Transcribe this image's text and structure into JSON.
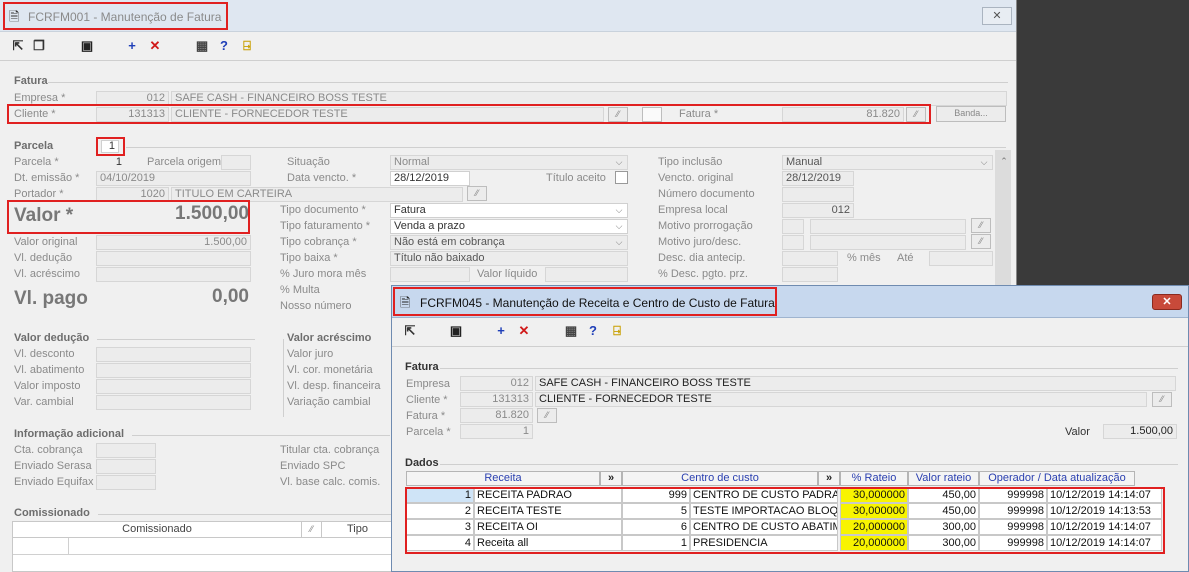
{
  "main_window": {
    "title": "FCRFM001 - Manutenção de Fatura",
    "close_glyph": "✕",
    "fatura": {
      "section": "Fatura",
      "empresa_label": "Empresa *",
      "empresa_code": "012",
      "empresa_name": "SAFE CASH - FINANCEIRO BOSS TESTE",
      "cliente_label": "Cliente *",
      "cliente_code": "131313",
      "cliente_name": "CLIENTE - FORNECEDOR TESTE",
      "fatura_label": "Fatura *",
      "fatura_value": "81.820",
      "banda_label": "Banda..."
    },
    "parcela": {
      "section": "Parcela",
      "section_value": "1",
      "parcela_label": "Parcela *",
      "parcela_value": "1",
      "parcela_origem_label": "Parcela origem",
      "dt_emissao_label": "Dt. emissão *",
      "dt_emissao_value": "04/10/2019",
      "portador_label": "Portador *",
      "portador_code": "1020",
      "portador_name": "TITULO EM CARTEIRA",
      "valor_label": "Valor *",
      "valor_value": "1.500,00",
      "valor_original_label": "Valor original",
      "valor_original_value": "1.500,00",
      "vl_deducao_label": "Vl. dedução",
      "vl_acrescimo_label": "Vl. acréscimo",
      "vl_pago_label": "Vl. pago",
      "vl_pago_value": "0,00",
      "situacao_label": "Situação",
      "situacao_value": "Normal",
      "data_vencto_label": "Data vencto. *",
      "data_vencto_value": "28/12/2019",
      "titulo_aceito_label": "Título aceito",
      "tipo_documento_label": "Tipo documento *",
      "tipo_documento_value": "Fatura",
      "tipo_faturamento_label": "Tipo faturamento *",
      "tipo_faturamento_value": "Venda a prazo",
      "tipo_cobranca_label": "Tipo cobrança *",
      "tipo_cobranca_value": "Não está em cobrança",
      "tipo_baixa_label": "Tipo baixa *",
      "tipo_baixa_value": "Título não baixado",
      "juro_mora_label": "% Juro mora mês",
      "valor_liquido_label": "Valor líquido",
      "multa_label": "% Multa",
      "nosso_numero_label": "Nosso número",
      "tipo_inclusao_label": "Tipo inclusão",
      "tipo_inclusao_value": "Manual",
      "vencto_original_label": "Vencto. original",
      "vencto_original_value": "28/12/2019",
      "numero_documento_label": "Número documento",
      "empresa_local_label": "Empresa local",
      "empresa_local_value": "012",
      "motivo_prorrogacao_label": "Motivo prorrogação",
      "motivo_juro_label": "Motivo juro/desc.",
      "desc_dia_antecip_label": "Desc. dia antecip.",
      "pct_mes_label": "% mês",
      "ate_label": "Até",
      "desc_pgto_label": "% Desc. pgto. prz."
    },
    "valor_deducao": {
      "section": "Valor dedução",
      "desconto": "Vl. desconto",
      "abatimento": "Vl. abatimento",
      "imposto": "Valor imposto",
      "cambial": "Var. cambial"
    },
    "valor_acrescimo": {
      "section": "Valor acréscimo",
      "juro": "Valor juro",
      "cor_monetaria": "Vl. cor. monetária",
      "desp_financeira": "Vl. desp. financeira",
      "variacao": "Variação cambial"
    },
    "info_adicional": {
      "section": "Informação adicional",
      "cta_cobranca": "Cta. cobrança",
      "serasa": "Enviado Serasa",
      "equifax": "Enviado Equifax",
      "titular": "Titular cta. cobrança",
      "spc": "Enviado SPC",
      "base_calc": "Vl. base calc. comis."
    },
    "comissionado": {
      "section": "Comissionado",
      "col_comissionado": "Comissionado",
      "col_tipo": "Tipo"
    }
  },
  "sub_window": {
    "title": "FCRFM045 - Manutenção de Receita e Centro de Custo de Fatura",
    "close_glyph": "✕",
    "fatura": {
      "section": "Fatura",
      "empresa_label": "Empresa",
      "empresa_code": "012",
      "empresa_name": "SAFE CASH - FINANCEIRO BOSS TESTE",
      "cliente_label": "Cliente *",
      "cliente_code": "131313",
      "cliente_name": "CLIENTE - FORNECEDOR TESTE",
      "fatura_label": "Fatura *",
      "fatura_value": "81.820",
      "parcela_label": "Parcela *",
      "parcela_value": "1",
      "valor_label": "Valor",
      "valor_value": "1.500,00"
    },
    "dados": {
      "section": "Dados",
      "headers": {
        "receita": "Receita",
        "centro": "Centro de custo",
        "rateio": "% Rateio",
        "valor_rateio": "Valor rateio",
        "operador": "Operador / Data atualização"
      },
      "rows": [
        {
          "n": "1",
          "receita": "RECEITA PADRAO",
          "cc_code": "999",
          "cc_name": "CENTRO DE CUSTO PADRAO",
          "rateio": "30,000000",
          "valor": "450,00",
          "operador": "999998",
          "data": "10/12/2019 14:14:07"
        },
        {
          "n": "2",
          "receita": "RECEITA TESTE",
          "cc_code": "5",
          "cc_name": "TESTE IMPORTACAO BLOQ",
          "rateio": "30,000000",
          "valor": "450,00",
          "operador": "999998",
          "data": "10/12/2019 14:13:53"
        },
        {
          "n": "3",
          "receita": "RECEITA OI",
          "cc_code": "6",
          "cc_name": "CENTRO DE CUSTO ABATIMEN",
          "rateio": "20,000000",
          "valor": "300,00",
          "operador": "999998",
          "data": "10/12/2019 14:14:07"
        },
        {
          "n": "4",
          "receita": "Receita all",
          "cc_code": "1",
          "cc_name": "PRESIDENCIA",
          "rateio": "20,000000",
          "valor": "300,00",
          "operador": "999998",
          "data": "10/12/2019 14:14:07"
        }
      ]
    }
  },
  "colors": {
    "highlight_red": "#e02020",
    "rateio_yellow": "#f8f400",
    "header_blue": "#2a3fb0"
  }
}
